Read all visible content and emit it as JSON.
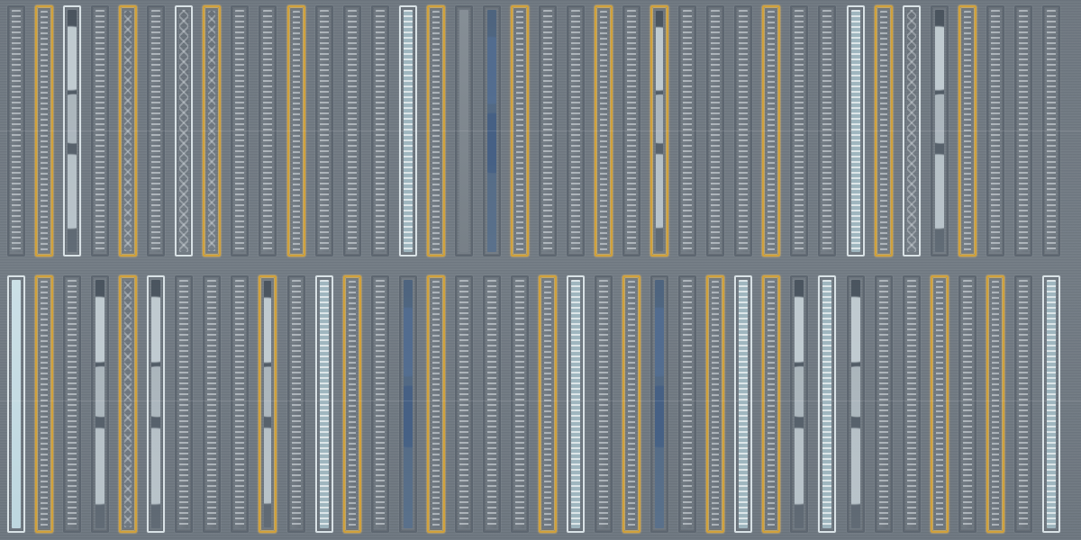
{
  "scene": {
    "colors": {
      "background": "#6f7880",
      "dark_strip": "#5d6670",
      "light_strip": "#d9e2e6",
      "gold_strip": "#d1a13b",
      "blue_accent": "#56728f",
      "pale_accent": "#b8d4dd"
    },
    "bands": [
      {
        "name": "top-band",
        "strips": [
          {
            "type": "stripes",
            "tone": "dark"
          },
          {
            "type": "stripes",
            "tone": "gold"
          },
          {
            "type": "swirl",
            "tone": "light"
          },
          {
            "type": "stripes",
            "tone": "dark"
          },
          {
            "type": "diamonds",
            "tone": "gold"
          },
          {
            "type": "stripes",
            "tone": "dark"
          },
          {
            "type": "diamonds",
            "tone": "light"
          },
          {
            "type": "diamonds",
            "tone": "gold"
          },
          {
            "type": "stripes",
            "tone": "dark"
          },
          {
            "type": "stripes",
            "tone": "dark"
          },
          {
            "type": "stripes",
            "tone": "gold"
          },
          {
            "type": "stripes",
            "tone": "dark"
          },
          {
            "type": "stripes",
            "tone": "dark"
          },
          {
            "type": "stripes",
            "tone": "dark"
          },
          {
            "type": "stripes",
            "tone": "light"
          },
          {
            "type": "stripes",
            "tone": "gold"
          },
          {
            "type": "plain",
            "tone": "dark"
          },
          {
            "type": "blue",
            "tone": "dark"
          },
          {
            "type": "stripes",
            "tone": "gold"
          },
          {
            "type": "stripes",
            "tone": "dark"
          },
          {
            "type": "stripes",
            "tone": "dark"
          },
          {
            "type": "stripes",
            "tone": "gold"
          },
          {
            "type": "stripes",
            "tone": "dark"
          },
          {
            "type": "swirl",
            "tone": "gold"
          },
          {
            "type": "stripes",
            "tone": "dark"
          },
          {
            "type": "stripes",
            "tone": "dark"
          },
          {
            "type": "stripes",
            "tone": "dark"
          },
          {
            "type": "stripes",
            "tone": "gold"
          },
          {
            "type": "stripes",
            "tone": "dark"
          },
          {
            "type": "stripes",
            "tone": "dark"
          },
          {
            "type": "stripes",
            "tone": "light"
          },
          {
            "type": "stripes",
            "tone": "gold"
          },
          {
            "type": "diamonds",
            "tone": "light"
          },
          {
            "type": "swirl",
            "tone": "dark"
          },
          {
            "type": "stripes",
            "tone": "gold"
          },
          {
            "type": "stripes",
            "tone": "dark"
          },
          {
            "type": "stripes",
            "tone": "dark"
          },
          {
            "type": "stripes",
            "tone": "dark"
          }
        ]
      },
      {
        "name": "bottom-band",
        "strips": [
          {
            "type": "plain",
            "tone": "light"
          },
          {
            "type": "stripes",
            "tone": "gold"
          },
          {
            "type": "stripes",
            "tone": "dark"
          },
          {
            "type": "swirl",
            "tone": "dark"
          },
          {
            "type": "diamonds",
            "tone": "gold"
          },
          {
            "type": "swirl",
            "tone": "light"
          },
          {
            "type": "stripes",
            "tone": "dark"
          },
          {
            "type": "stripes",
            "tone": "dark"
          },
          {
            "type": "stripes",
            "tone": "dark"
          },
          {
            "type": "swirl",
            "tone": "gold"
          },
          {
            "type": "stripes",
            "tone": "dark"
          },
          {
            "type": "stripes",
            "tone": "light"
          },
          {
            "type": "stripes",
            "tone": "gold"
          },
          {
            "type": "stripes",
            "tone": "dark"
          },
          {
            "type": "blue",
            "tone": "dark"
          },
          {
            "type": "stripes",
            "tone": "gold"
          },
          {
            "type": "stripes",
            "tone": "dark"
          },
          {
            "type": "stripes",
            "tone": "dark"
          },
          {
            "type": "stripes",
            "tone": "dark"
          },
          {
            "type": "stripes",
            "tone": "gold"
          },
          {
            "type": "stripes",
            "tone": "light"
          },
          {
            "type": "stripes",
            "tone": "dark"
          },
          {
            "type": "stripes",
            "tone": "gold"
          },
          {
            "type": "blue",
            "tone": "dark"
          },
          {
            "type": "stripes",
            "tone": "dark"
          },
          {
            "type": "stripes",
            "tone": "gold"
          },
          {
            "type": "stripes",
            "tone": "light"
          },
          {
            "type": "stripes",
            "tone": "gold"
          },
          {
            "type": "swirl",
            "tone": "dark"
          },
          {
            "type": "stripes",
            "tone": "light"
          },
          {
            "type": "swirl",
            "tone": "dark"
          },
          {
            "type": "stripes",
            "tone": "dark"
          },
          {
            "type": "stripes",
            "tone": "dark"
          },
          {
            "type": "stripes",
            "tone": "gold"
          },
          {
            "type": "stripes",
            "tone": "dark"
          },
          {
            "type": "stripes",
            "tone": "gold"
          },
          {
            "type": "stripes",
            "tone": "dark"
          },
          {
            "type": "stripes",
            "tone": "light"
          }
        ]
      }
    ]
  }
}
